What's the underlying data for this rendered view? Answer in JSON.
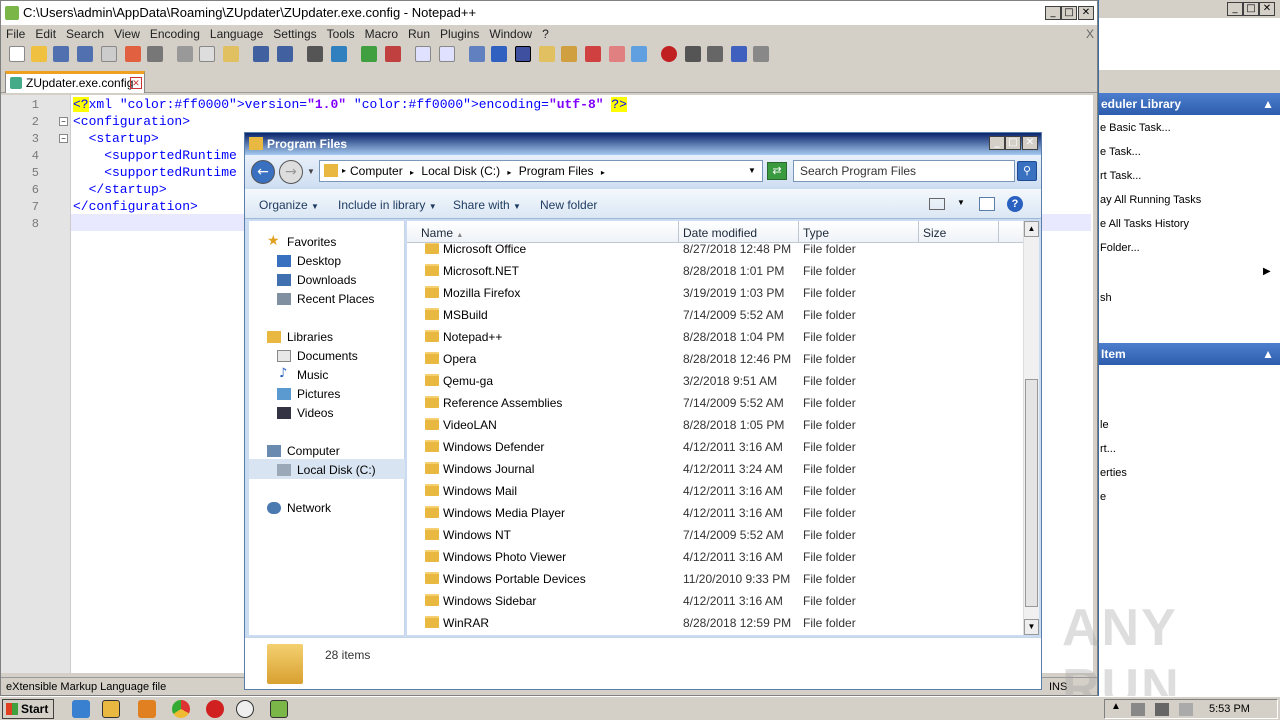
{
  "npp": {
    "title": "C:\\Users\\admin\\AppData\\Roaming\\ZUpdater\\ZUpdater.exe.config - Notepad++",
    "menu": [
      "File",
      "Edit",
      "Search",
      "View",
      "Encoding",
      "Language",
      "Settings",
      "Tools",
      "Macro",
      "Run",
      "Plugins",
      "Window",
      "?"
    ],
    "close_x": "X",
    "tab_label": "ZUpdater.exe.config",
    "line_numbers": [
      "1",
      "2",
      "3",
      "4",
      "5",
      "6",
      "7",
      "8"
    ],
    "lines": [
      "<?xml version=\"1.0\" encoding=\"utf-8\" ?>",
      "<configuration>",
      "  <startup>",
      "    <supportedRuntime",
      "    <supportedRuntime",
      "  </startup>",
      "</configuration>",
      ""
    ],
    "status_left": "eXtensible Markup Language file",
    "status_ins": "INS"
  },
  "right_panel": {
    "section1": "eduler Library",
    "items1": [
      "e Basic Task...",
      "e Task...",
      "rt Task...",
      "ay All Running Tasks",
      "e All Tasks History",
      "Folder...",
      "",
      "sh"
    ],
    "section2": "Item",
    "items2": [
      "le",
      "rt...",
      "erties",
      "e"
    ]
  },
  "explorer": {
    "title": "Program Files",
    "breadcrumb": [
      "Computer",
      "Local Disk (C:)",
      "Program Files"
    ],
    "search_placeholder": "Search Program Files",
    "commands": [
      "Organize",
      "Include in library",
      "Share with",
      "New folder"
    ],
    "nav": {
      "favorites": "Favorites",
      "fav_items": [
        "Desktop",
        "Downloads",
        "Recent Places"
      ],
      "libraries": "Libraries",
      "lib_items": [
        "Documents",
        "Music",
        "Pictures",
        "Videos"
      ],
      "computer": "Computer",
      "comp_items": [
        "Local Disk (C:)"
      ],
      "network": "Network"
    },
    "columns": [
      "Name",
      "Date modified",
      "Type",
      "Size"
    ],
    "rows": [
      {
        "name": "Microsoft Office",
        "date": "8/27/2018 12:48 PM",
        "type": "File folder"
      },
      {
        "name": "Microsoft.NET",
        "date": "8/28/2018 1:01 PM",
        "type": "File folder"
      },
      {
        "name": "Mozilla Firefox",
        "date": "3/19/2019 1:03 PM",
        "type": "File folder"
      },
      {
        "name": "MSBuild",
        "date": "7/14/2009 5:52 AM",
        "type": "File folder"
      },
      {
        "name": "Notepad++",
        "date": "8/28/2018 1:04 PM",
        "type": "File folder"
      },
      {
        "name": "Opera",
        "date": "8/28/2018 12:46 PM",
        "type": "File folder"
      },
      {
        "name": "Qemu-ga",
        "date": "3/2/2018 9:51 AM",
        "type": "File folder"
      },
      {
        "name": "Reference Assemblies",
        "date": "7/14/2009 5:52 AM",
        "type": "File folder"
      },
      {
        "name": "VideoLAN",
        "date": "8/28/2018 1:05 PM",
        "type": "File folder"
      },
      {
        "name": "Windows Defender",
        "date": "4/12/2011 3:16 AM",
        "type": "File folder"
      },
      {
        "name": "Windows Journal",
        "date": "4/12/2011 3:24 AM",
        "type": "File folder"
      },
      {
        "name": "Windows Mail",
        "date": "4/12/2011 3:16 AM",
        "type": "File folder"
      },
      {
        "name": "Windows Media Player",
        "date": "4/12/2011 3:16 AM",
        "type": "File folder"
      },
      {
        "name": "Windows NT",
        "date": "7/14/2009 5:52 AM",
        "type": "File folder"
      },
      {
        "name": "Windows Photo Viewer",
        "date": "4/12/2011 3:16 AM",
        "type": "File folder"
      },
      {
        "name": "Windows Portable Devices",
        "date": "11/20/2010 9:33 PM",
        "type": "File folder"
      },
      {
        "name": "Windows Sidebar",
        "date": "4/12/2011 3:16 AM",
        "type": "File folder"
      },
      {
        "name": "WinRAR",
        "date": "8/28/2018 12:59 PM",
        "type": "File folder"
      }
    ],
    "item_count": "28 items"
  },
  "taskbar": {
    "start": "Start",
    "clock": "5:53 PM"
  },
  "watermark": "ANY RUN",
  "colors": {
    "accent": "#2e5cad",
    "folder": "#e8b840",
    "xml_tag": "#0000ff",
    "xml_attr": "#ff0000",
    "xml_value": "#8000ff"
  }
}
